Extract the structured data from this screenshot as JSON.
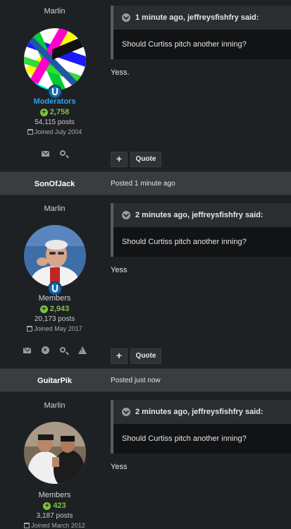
{
  "posts": [
    {
      "group_title": "Marlin",
      "group_name": "Moderators",
      "reputation": "2,758",
      "posts_count": "54,115 posts",
      "joined": "Joined July 2004",
      "quote_cite": "1 minute ago, jeffreysfishfry said:",
      "quote_text": "Should Curtiss pitch another inning?",
      "body": "Yess."
    },
    {
      "author": "SonOfJack",
      "date": "Posted 1 minute ago",
      "group_title": "Marlin",
      "group_name": "Members",
      "reputation": "2,943",
      "posts_count": "20,173 posts",
      "joined": "Joined May 2017",
      "quote_cite": "2 minutes ago, jeffreysfishfry said:",
      "quote_text": "Should Curtiss pitch another inning?",
      "body": "Yess"
    },
    {
      "author": "GuitarPik",
      "date": "Posted just now",
      "group_title": "Marlin",
      "group_name": "Members",
      "reputation": "423",
      "posts_count": "3,187 posts",
      "joined": "Joined March 2012",
      "quote_cite": "2 minutes ago, jeffreysfishfry said:",
      "quote_text": "Should Curtiss pitch another inning?",
      "body": "Yess"
    }
  ],
  "actions": {
    "plus_label": "+",
    "quote_label": "Quote"
  },
  "icons": {
    "rep": "plus-circle-icon",
    "joined": "calendar-icon",
    "message": "envelope-icon",
    "search": "search-icon",
    "ignore": "block-icon",
    "report": "warning-icon",
    "cite": "chevron-down-circle-icon"
  },
  "colors": {
    "moderator": "#2fa4e7",
    "reputation": "#7dc242",
    "header_bg": "#3a3d40",
    "page_bg": "#1e2124"
  }
}
